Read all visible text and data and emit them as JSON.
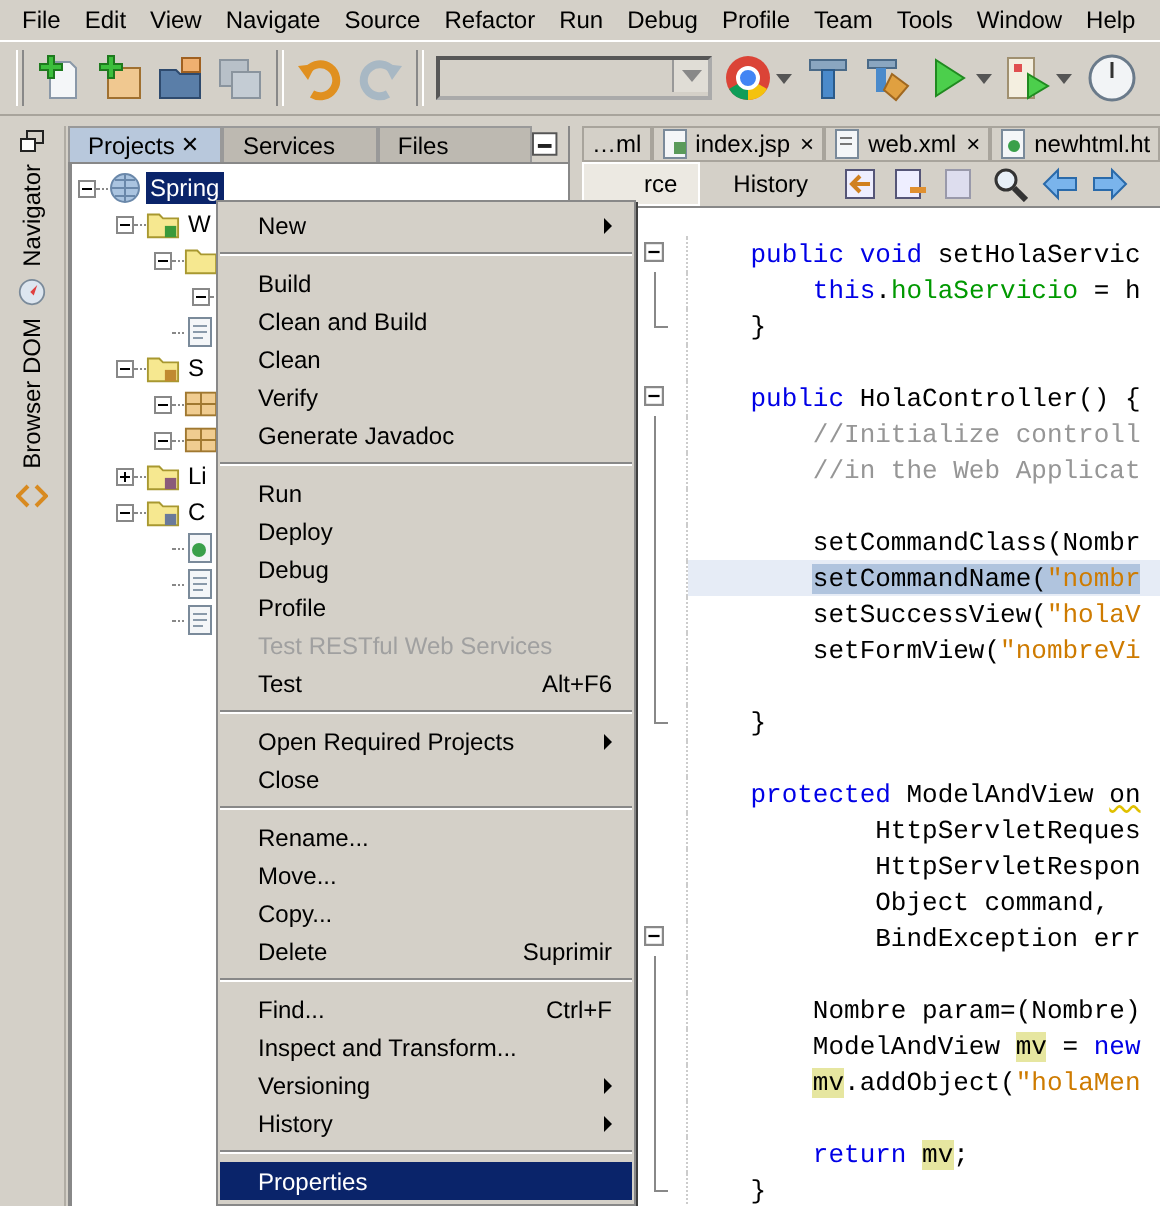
{
  "menu_bar": [
    "File",
    "Edit",
    "View",
    "Navigate",
    "Source",
    "Refactor",
    "Run",
    "Debug",
    "Profile",
    "Team",
    "Tools",
    "Window",
    "Help"
  ],
  "side_strip": {
    "tabs": [
      "Navigator",
      "Browser DOM"
    ]
  },
  "projects_panel": {
    "tabs": [
      {
        "label": "Projects",
        "selected": true,
        "close": "✕"
      },
      {
        "label": "Services",
        "selected": false
      },
      {
        "label": "Files",
        "selected": false
      }
    ],
    "tree": [
      {
        "label": "Spring",
        "kind": "project",
        "expanded": true,
        "selected": true,
        "children": [
          {
            "label": "W",
            "kind": "webfolder",
            "expanded": true,
            "selected": false,
            "children": [
              {
                "kind": "folder",
                "expanded": true,
                "selected": false,
                "children": [
                  {
                    "expanded": true,
                    "selected": false
                  }
                ]
              },
              {
                "kind": "file",
                "selected": false
              }
            ]
          },
          {
            "label": "S",
            "kind": "srcfolder",
            "expanded": true,
            "selected": false,
            "children": [
              {
                "kind": "package",
                "expanded": true,
                "selected": false
              },
              {
                "kind": "package",
                "expanded": true,
                "selected": false
              }
            ]
          },
          {
            "label": "Li",
            "kind": "libfolder",
            "expanded": false,
            "selected": false
          },
          {
            "label": "C",
            "kind": "conffolder",
            "expanded": true,
            "selected": false,
            "children": [
              {
                "kind": "webfile",
                "selected": false
              },
              {
                "kind": "file",
                "selected": false
              },
              {
                "kind": "file",
                "selected": false
              }
            ]
          }
        ]
      }
    ]
  },
  "editor": {
    "tabs": [
      {
        "label": "…ml",
        "kind": "plain"
      },
      {
        "label": "index.jsp",
        "kind": "jsp",
        "close": "×"
      },
      {
        "label": "web.xml",
        "kind": "xml",
        "close": "×"
      },
      {
        "label": "newhtml.ht",
        "kind": "html"
      }
    ],
    "views": [
      {
        "label": "rce",
        "selected": true
      },
      {
        "label": "History",
        "selected": false
      }
    ],
    "code": [
      {
        "kind": "member",
        "fold_button": true,
        "tokens": [
          {
            "text": "public void",
            "kind": "keyword"
          },
          {
            "text": " setHolaServic",
            "kind": "plain"
          }
        ]
      },
      {
        "kind": "body",
        "fold_button": false,
        "tokens": [
          {
            "text": "this",
            "kind": "keyword"
          },
          {
            "text": ".",
            "kind": "plain"
          },
          {
            "text": "holaServicio",
            "kind": "field"
          },
          {
            "text": " = h",
            "kind": "plain"
          }
        ]
      },
      {
        "kind": "member",
        "fold_button": false,
        "tokens": [
          {
            "text": "}",
            "kind": "plain"
          }
        ]
      },
      {
        "kind": "blank",
        "fold_button": false
      },
      {
        "kind": "member",
        "fold_button": true,
        "tokens": [
          {
            "text": "public",
            "kind": "keyword"
          },
          {
            "text": " HolaController() {",
            "kind": "plain"
          }
        ]
      },
      {
        "kind": "body",
        "fold_button": false,
        "tokens": [
          {
            "text": "//Initialize controll",
            "kind": "comment"
          }
        ]
      },
      {
        "kind": "body",
        "fold_button": false,
        "tokens": [
          {
            "text": "//in the Web Applicat",
            "kind": "comment"
          }
        ]
      },
      {
        "kind": "blank",
        "fold_button": false
      },
      {
        "kind": "body",
        "fold_button": false,
        "tokens": [
          {
            "text": "setCommandClass(Nombr",
            "kind": "plain"
          }
        ]
      },
      {
        "kind": "body",
        "fold_button": false,
        "current": true,
        "tokens": [
          {
            "text": "setCommandName(",
            "kind": "selected"
          },
          {
            "text": "\"nombr",
            "kind": "selected-string"
          }
        ]
      },
      {
        "kind": "body",
        "fold_button": false,
        "tokens": [
          {
            "text": "setSuccessView(",
            "kind": "plain"
          },
          {
            "text": "\"holaV",
            "kind": "string"
          }
        ]
      },
      {
        "kind": "body",
        "fold_button": false,
        "tokens": [
          {
            "text": "setFormView(",
            "kind": "plain"
          },
          {
            "text": "\"nombreVi",
            "kind": "string"
          }
        ]
      },
      {
        "kind": "blank",
        "fold_button": false
      },
      {
        "kind": "member",
        "fold_button": false,
        "tokens": [
          {
            "text": "}",
            "kind": "plain"
          }
        ]
      },
      {
        "kind": "blank",
        "fold_button": false
      },
      {
        "kind": "member",
        "fold_button": false,
        "tokens": [
          {
            "text": "protected",
            "kind": "keyword"
          },
          {
            "text": " ModelAndView ",
            "kind": "plain"
          },
          {
            "text": "on",
            "kind": "warning"
          }
        ]
      },
      {
        "kind": "param",
        "fold_button": false,
        "tokens": [
          {
            "text": "HttpServletReques",
            "kind": "plain"
          }
        ]
      },
      {
        "kind": "param",
        "fold_button": false,
        "tokens": [
          {
            "text": "HttpServletRespon",
            "kind": "plain"
          }
        ]
      },
      {
        "kind": "param",
        "fold_button": false,
        "tokens": [
          {
            "text": "Object command,",
            "kind": "plain"
          }
        ]
      },
      {
        "kind": "param",
        "fold_button": true,
        "tokens": [
          {
            "text": "BindException err",
            "kind": "plain"
          }
        ]
      },
      {
        "kind": "blank",
        "fold_button": false
      },
      {
        "kind": "body",
        "fold_button": false,
        "tokens": [
          {
            "text": "Nombre param=(Nombre)",
            "kind": "plain"
          }
        ]
      },
      {
        "kind": "body",
        "fold_button": false,
        "tokens": [
          {
            "text": "ModelAndView ",
            "kind": "plain"
          },
          {
            "text": "mv",
            "kind": "occurrence"
          },
          {
            "text": " = ",
            "kind": "plain"
          },
          {
            "text": "new",
            "kind": "keyword"
          }
        ]
      },
      {
        "kind": "body",
        "fold_button": false,
        "tokens": [
          {
            "text": "mv",
            "kind": "occurrence"
          },
          {
            "text": ".addObject(",
            "kind": "plain"
          },
          {
            "text": "\"holaMen",
            "kind": "string"
          }
        ]
      },
      {
        "kind": "blank",
        "fold_button": false
      },
      {
        "kind": "body",
        "fold_button": false,
        "tokens": [
          {
            "text": "return ",
            "kind": "keyword"
          },
          {
            "text": "mv",
            "kind": "occurrence"
          },
          {
            "text": ";",
            "kind": "plain"
          }
        ]
      },
      {
        "kind": "member",
        "fold_button": false,
        "tokens": [
          {
            "text": "}",
            "kind": "plain"
          }
        ]
      }
    ]
  },
  "context_menu": [
    {
      "kind": "item",
      "label": "New",
      "submenu": true,
      "disabled": false,
      "selected": false
    },
    {
      "kind": "separator"
    },
    {
      "kind": "item",
      "label": "Build",
      "disabled": false,
      "selected": false
    },
    {
      "kind": "item",
      "label": "Clean and Build",
      "disabled": false,
      "selected": false
    },
    {
      "kind": "item",
      "label": "Clean",
      "disabled": false,
      "selected": false
    },
    {
      "kind": "item",
      "label": "Verify",
      "disabled": false,
      "selected": false
    },
    {
      "kind": "item",
      "label": "Generate Javadoc",
      "disabled": false,
      "selected": false
    },
    {
      "kind": "separator"
    },
    {
      "kind": "item",
      "label": "Run",
      "disabled": false,
      "selected": false
    },
    {
      "kind": "item",
      "label": "Deploy",
      "disabled": false,
      "selected": false
    },
    {
      "kind": "item",
      "label": "Debug",
      "disabled": false,
      "selected": false
    },
    {
      "kind": "item",
      "label": "Profile",
      "disabled": false,
      "selected": false
    },
    {
      "kind": "item",
      "label": "Test RESTful Web Services",
      "disabled": true,
      "selected": false
    },
    {
      "kind": "item",
      "label": "Test",
      "shortcut": "Alt+F6",
      "disabled": false,
      "selected": false
    },
    {
      "kind": "separator"
    },
    {
      "kind": "item",
      "label": "Open Required Projects",
      "submenu": true,
      "disabled": false,
      "selected": false
    },
    {
      "kind": "item",
      "label": "Close",
      "disabled": false,
      "selected": false
    },
    {
      "kind": "separator"
    },
    {
      "kind": "item",
      "label": "Rename...",
      "disabled": false,
      "selected": false
    },
    {
      "kind": "item",
      "label": "Move...",
      "disabled": false,
      "selected": false
    },
    {
      "kind": "item",
      "label": "Copy...",
      "disabled": false,
      "selected": false
    },
    {
      "kind": "item",
      "label": "Delete",
      "shortcut": "Suprimir",
      "disabled": false,
      "selected": false
    },
    {
      "kind": "separator"
    },
    {
      "kind": "item",
      "label": "Find...",
      "shortcut": "Ctrl+F",
      "disabled": false,
      "selected": false
    },
    {
      "kind": "item",
      "label": "Inspect and Transform...",
      "disabled": false,
      "selected": false
    },
    {
      "kind": "item",
      "label": "Versioning",
      "submenu": true,
      "disabled": false,
      "selected": false
    },
    {
      "kind": "item",
      "label": "History",
      "submenu": true,
      "disabled": false,
      "selected": false
    },
    {
      "kind": "separator"
    },
    {
      "kind": "item",
      "label": "Properties",
      "disabled": false,
      "selected": true
    }
  ]
}
